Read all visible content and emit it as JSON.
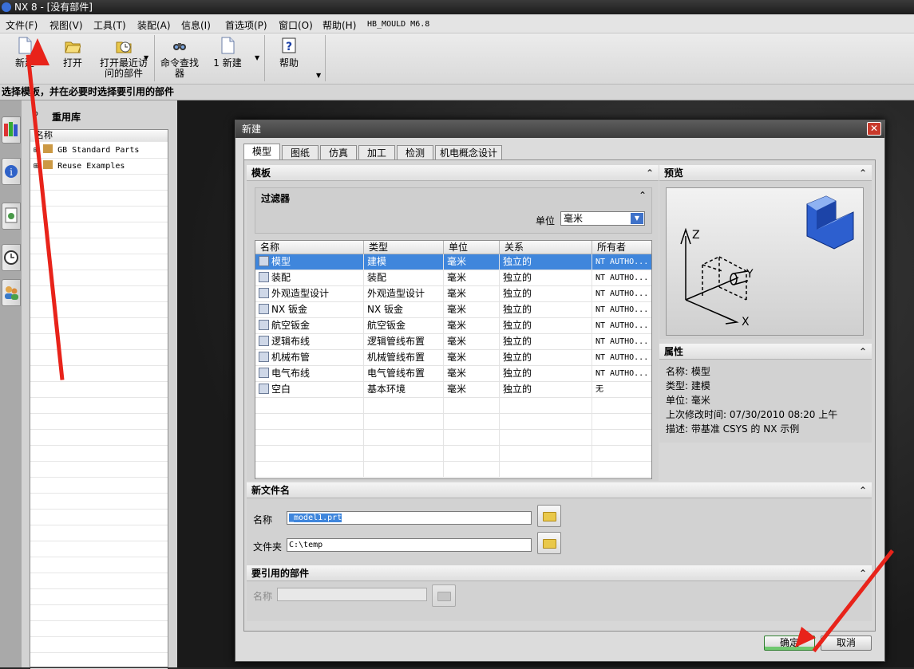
{
  "app": {
    "title": "NX 8 - [没有部件]"
  },
  "menu": [
    "文件(F)",
    "视图(V)",
    "工具(T)",
    "装配(A)",
    "信息(I)",
    "首选项(P)",
    "窗口(O)",
    "帮助(H)",
    "HB_MOULD M6.8"
  ],
  "toolbar": {
    "new": "新建",
    "open": "打开",
    "recent_1": "打开最近访",
    "recent_2": "问的部件",
    "cmd_1": "命令查找",
    "cmd_2": "器",
    "new2": "1 新建",
    "help": "帮助"
  },
  "cue_line": "选择模板，并在必要时选择要引用的部件",
  "resource": {
    "header": "重用库",
    "col_name": "名称",
    "items": [
      "GB Standard Parts",
      "Reuse Examples"
    ]
  },
  "dialog": {
    "title": "新建",
    "close": "✕",
    "tabs": [
      "模型",
      "图纸",
      "仿真",
      "加工",
      "检测",
      "机电概念设计"
    ],
    "template_header": "模板",
    "filter_header": "过滤器",
    "unit_label": "单位",
    "unit_value": "毫米",
    "columns": [
      "名称",
      "类型",
      "单位",
      "关系",
      "所有者"
    ],
    "rows": [
      {
        "name": "模型",
        "type": "建模",
        "unit": "毫米",
        "rel": "独立的",
        "owner": "NT AUTHO..."
      },
      {
        "name": "装配",
        "type": "装配",
        "unit": "毫米",
        "rel": "独立的",
        "owner": "NT AUTHO..."
      },
      {
        "name": "外观造型设计",
        "type": "外观造型设计",
        "unit": "毫米",
        "rel": "独立的",
        "owner": "NT AUTHO..."
      },
      {
        "name": "NX 钣金",
        "type": "NX 钣金",
        "unit": "毫米",
        "rel": "独立的",
        "owner": "NT AUTHO..."
      },
      {
        "name": "航空钣金",
        "type": "航空钣金",
        "unit": "毫米",
        "rel": "独立的",
        "owner": "NT AUTHO..."
      },
      {
        "name": "逻辑布线",
        "type": "逻辑管线布置",
        "unit": "毫米",
        "rel": "独立的",
        "owner": "NT AUTHO..."
      },
      {
        "name": "机械布管",
        "type": "机械管线布置",
        "unit": "毫米",
        "rel": "独立的",
        "owner": "NT AUTHO..."
      },
      {
        "name": "电气布线",
        "type": "电气管线布置",
        "unit": "毫米",
        "rel": "独立的",
        "owner": "NT AUTHO..."
      },
      {
        "name": "空白",
        "type": "基本环境",
        "unit": "毫米",
        "rel": "独立的",
        "owner": "无"
      }
    ],
    "preview_header": "预览",
    "axis": {
      "z": "Z",
      "y": "Y",
      "x": "X"
    },
    "props_header": "属性",
    "props": [
      "名称:  模型",
      "类型:  建模",
      "单位:  毫米",
      "上次修改时间:  07/30/2010 08:20 上午",
      "描述:  带基准 CSYS 的 NX 示例"
    ],
    "newfile_header": "新文件名",
    "name_label": "名称",
    "name_value": "_model1.prt",
    "folder_label": "文件夹",
    "folder_value": "C:\\temp",
    "ref_header": "要引用的部件",
    "ref_name_label": "名称",
    "ok": "确定",
    "cancel": "取消"
  },
  "colors": {
    "selection": "#3f86dc",
    "annotation_arrow": "#e8231a"
  }
}
